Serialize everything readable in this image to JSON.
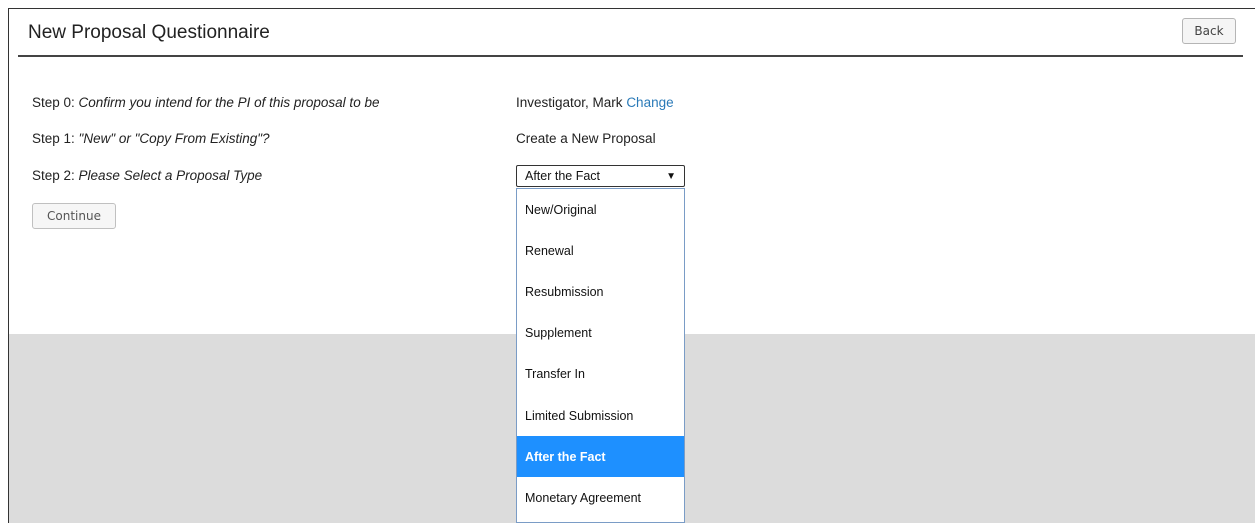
{
  "header": {
    "title": "New Proposal Questionnaire",
    "back_label": "Back"
  },
  "steps": [
    {
      "prefix": "Step 0: ",
      "text": "Confirm you intend for the PI of this proposal to be",
      "value": "Investigator, Mark",
      "link": "Change"
    },
    {
      "prefix": "Step 1: ",
      "text": "\"New\" or \"Copy From Existing\"?",
      "value": "Create a New Proposal"
    },
    {
      "prefix": "Step 2: ",
      "text": "Please Select a Proposal Type"
    }
  ],
  "proposal_type": {
    "selected": "After the Fact",
    "options": [
      "New/Original",
      "Renewal",
      "Resubmission",
      "Supplement",
      "Transfer In",
      "Limited Submission",
      "After the Fact",
      "Monetary Agreement"
    ]
  },
  "continue_label": "Continue",
  "colors": {
    "link": "#2a7ab8",
    "selected_option": "#1e90ff",
    "overlay_gray": "#dcdcdc"
  }
}
